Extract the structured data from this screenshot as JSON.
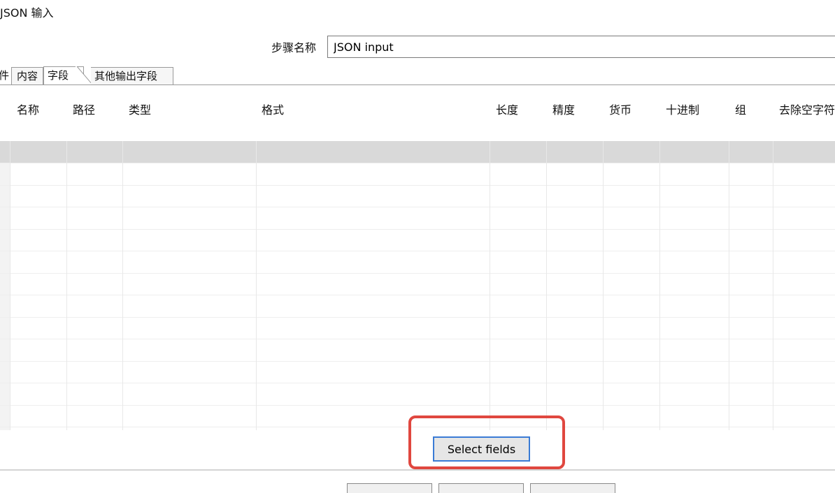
{
  "window": {
    "title": "JSON 输入"
  },
  "step": {
    "label": "步骤名称",
    "value": "JSON input"
  },
  "tabs": [
    {
      "label": "件",
      "state": "cut-off"
    },
    {
      "label": "内容",
      "state": "inactive"
    },
    {
      "label": "字段",
      "state": "active"
    },
    {
      "label": "其他输出字段",
      "state": "inactive"
    }
  ],
  "table": {
    "columns": [
      "名称",
      "路径",
      "类型",
      "格式",
      "长度",
      "精度",
      "货币",
      "十进制",
      "组",
      "去除空字符"
    ],
    "rows": []
  },
  "buttons": {
    "select_fields": "Select fields"
  },
  "colors": {
    "highlight": "#e0473f",
    "focus_border": "#3a7bd5",
    "selected_row": "#d9d9d9"
  }
}
